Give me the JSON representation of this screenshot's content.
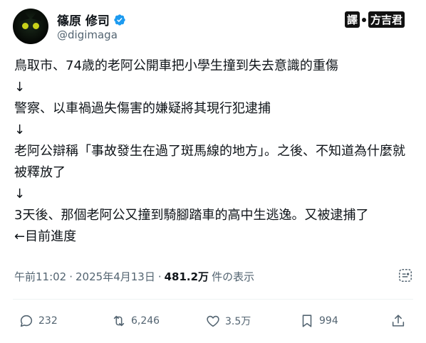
{
  "author": {
    "display_name": "篠原 修司",
    "handle": "@digimaga",
    "verified_icon": "verified-badge-icon",
    "verified_color": "#1d9bf0"
  },
  "watermark": {
    "part1": "譯",
    "part2": "方吉君"
  },
  "body": {
    "line1": "鳥取市、74歳的老阿公開車把小學生撞到失去意識的重傷",
    "arrow1": "↓",
    "line2": "警察、以車禍過失傷害的嫌疑將其現行犯逮捕",
    "arrow2": "↓",
    "line3": "老阿公辯稱「事故發生在過了斑馬線的地方」。之後、不知道為什麼就被釋放了",
    "arrow3": "↓",
    "line4": "3天後、那個老阿公又撞到騎腳踏車的高中生逃逸。又被逮捕了",
    "line5": "←目前進度"
  },
  "meta": {
    "time": "午前11:02",
    "separator1": "·",
    "date": "2025年4月13日",
    "separator2": "·",
    "views_count": "481.2万",
    "views_label": "件の表示"
  },
  "actions": {
    "reply_count": "232",
    "retweet_count": "6,246",
    "like_count": "3.5万",
    "bookmark_count": "994"
  },
  "colors": {
    "text": "#0f1419",
    "secondary": "#536471",
    "divider": "#eff3f4"
  }
}
